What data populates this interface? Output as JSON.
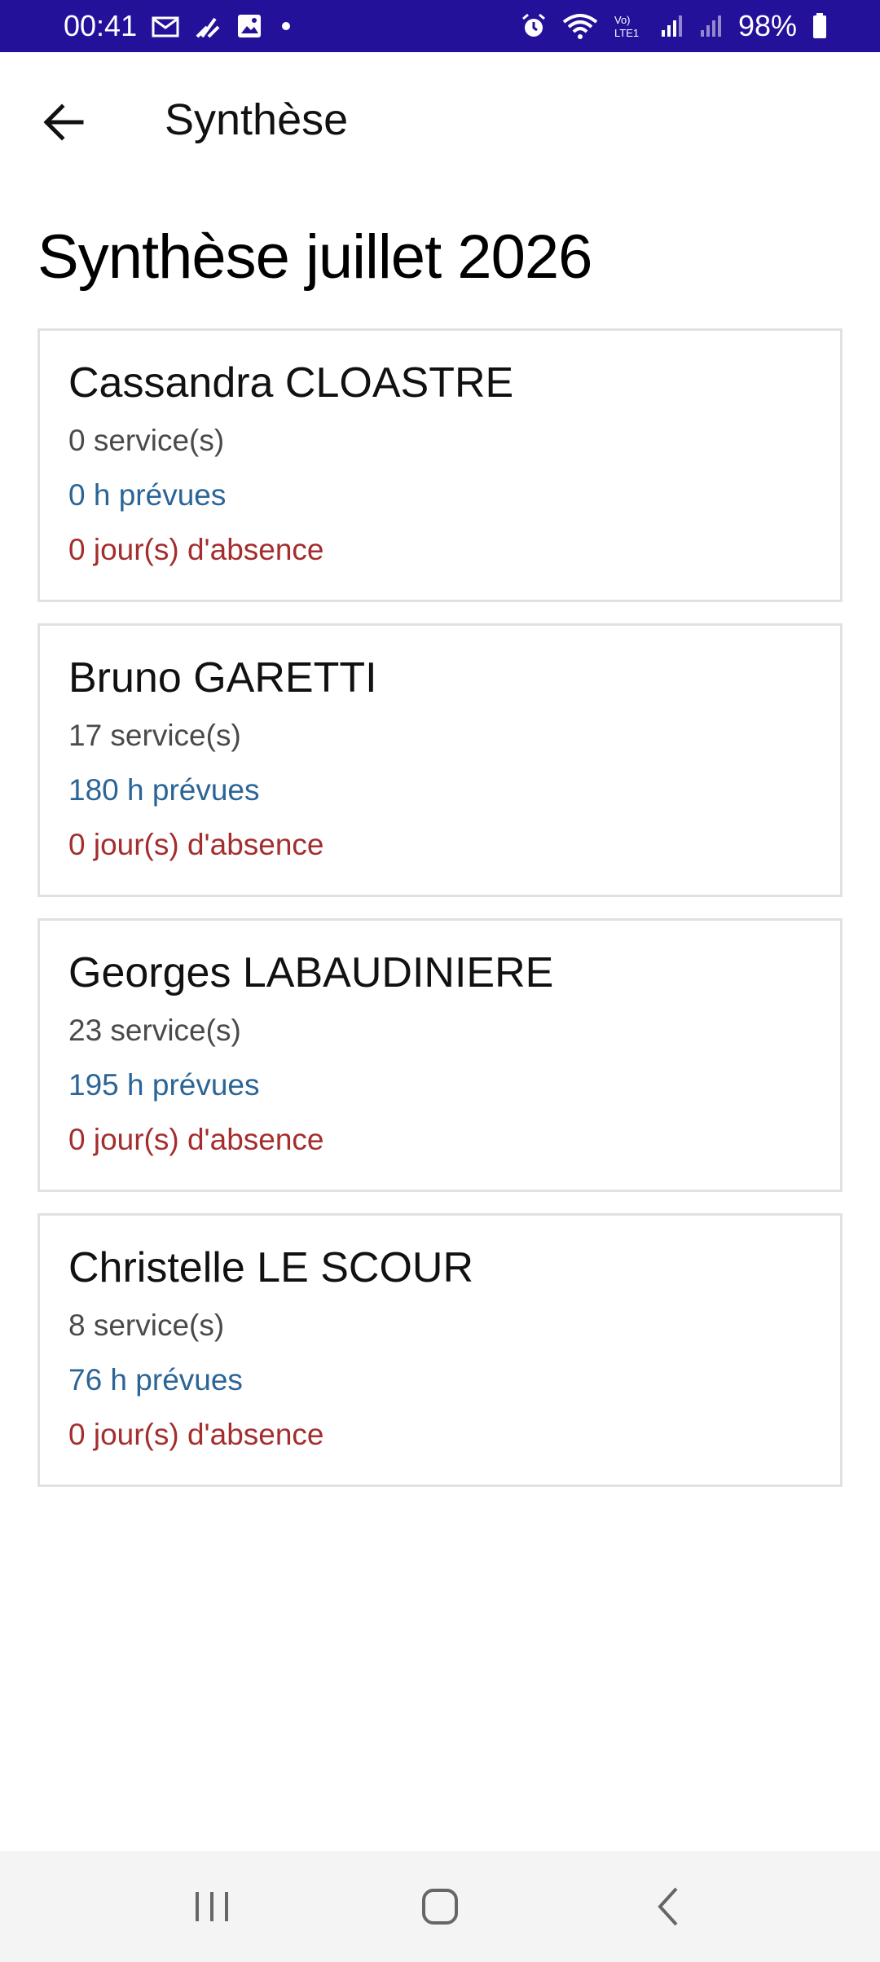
{
  "status_bar": {
    "time": "00:41",
    "battery": "98%",
    "icons": [
      "mail-icon",
      "app-icon",
      "image-icon",
      "alarm-icon",
      "wifi-icon",
      "volte-icon",
      "signal-icon",
      "signal-icon",
      "battery-icon"
    ]
  },
  "app_bar": {
    "title": "Synthèse",
    "back_icon": "arrow-left-icon"
  },
  "page": {
    "heading": "Synthèse juillet 2026"
  },
  "cards": [
    {
      "name": "Cassandra CLOASTRE",
      "services": "0 service(s)",
      "hours": "0 h prévues",
      "absence": "0 jour(s) d'absence"
    },
    {
      "name": "Bruno GARETTI",
      "services": "17 service(s)",
      "hours": "180 h prévues",
      "absence": "0 jour(s) d'absence"
    },
    {
      "name": "Georges LABAUDINIERE",
      "services": "23 service(s)",
      "hours": "195 h prévues",
      "absence": "0 jour(s) d'absence"
    },
    {
      "name": "Christelle LE SCOUR",
      "services": "8 service(s)",
      "hours": "76 h prévues",
      "absence": "0 jour(s) d'absence"
    }
  ],
  "colors": {
    "status_bar": "#23119a",
    "services_text": "#4a4a4a",
    "hours_text": "#2b6596",
    "absence_text": "#a42e2e",
    "card_border": "#e1e1e1"
  },
  "nav_bar": {
    "icons": [
      "recent-apps-icon",
      "home-icon",
      "back-icon"
    ]
  }
}
